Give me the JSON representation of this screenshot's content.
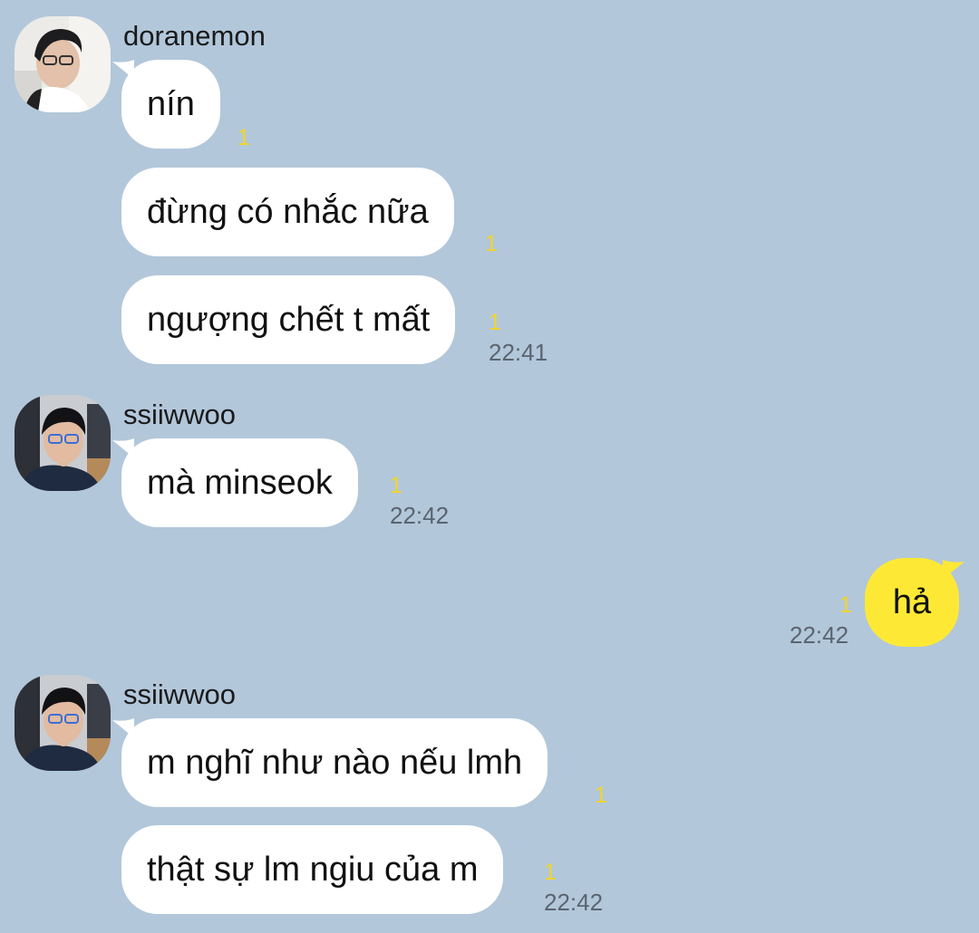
{
  "colors": {
    "background": "#b2c7da",
    "incoming_bubble": "#ffffff",
    "outgoing_bubble": "#fde935",
    "unread_counter": "#f1d52a",
    "timestamp": "#5a6470"
  },
  "groups": [
    {
      "sender": "doranemon",
      "avatar": "profile-photo",
      "messages": [
        {
          "text": "nín",
          "unread": "1"
        },
        {
          "text": "đừng có nhắc nữa",
          "unread": "1"
        },
        {
          "text": "ngượng chết t mất",
          "unread": "1",
          "time": "22:41"
        }
      ]
    },
    {
      "sender": "ssiiwwoo",
      "avatar": "profile-photo",
      "messages": [
        {
          "text": "mà minseok",
          "unread": "1",
          "time": "22:42"
        }
      ]
    },
    {
      "outgoing": true,
      "messages": [
        {
          "text": "hả",
          "unread": "1",
          "time": "22:42"
        }
      ]
    },
    {
      "sender": "ssiiwwoo",
      "avatar": "profile-photo",
      "messages": [
        {
          "text": "m nghĩ như nào nếu lmh",
          "unread": "1"
        },
        {
          "text": "thật sự lm ngiu của m",
          "unread": "1",
          "time": "22:42"
        }
      ]
    }
  ]
}
